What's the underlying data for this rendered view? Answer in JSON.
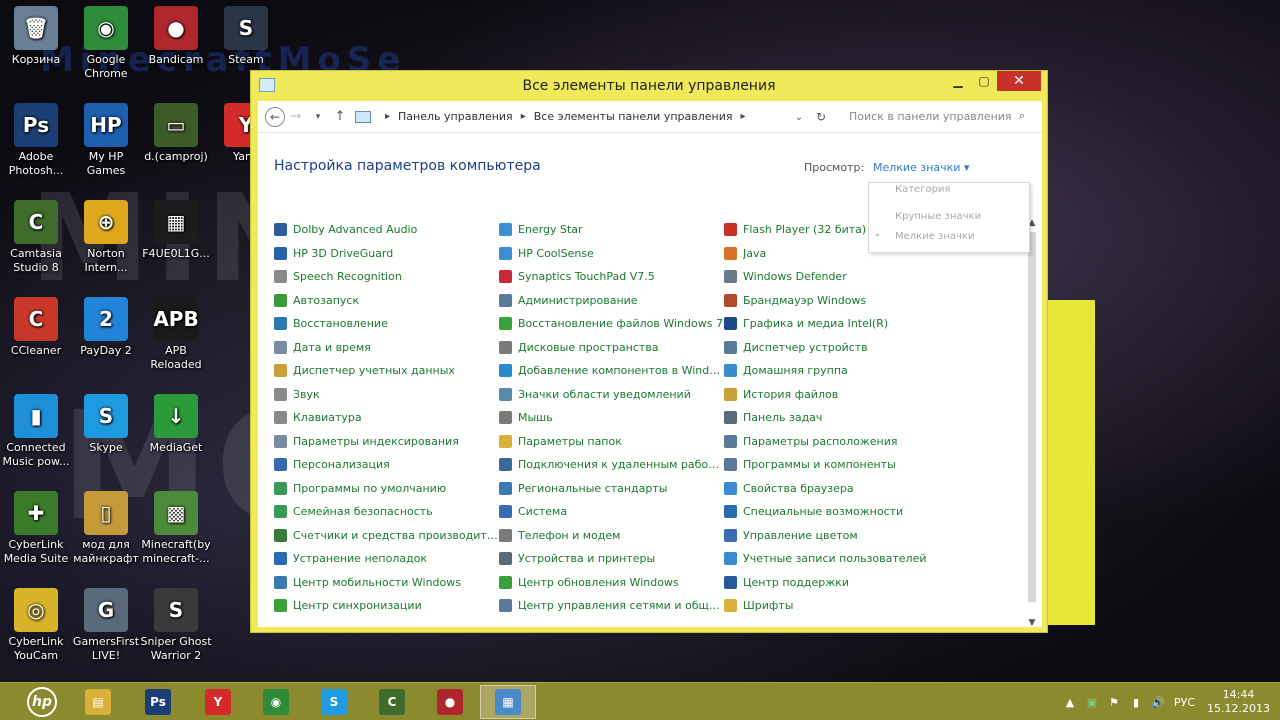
{
  "desktop": {
    "icons": [
      {
        "label": "Корзина",
        "icon": "recycle-bin-icon",
        "color": "#6a7f95",
        "glyph": "🗑"
      },
      {
        "label": "Google Chrome",
        "icon": "chrome-icon",
        "color": "#2e8b3a",
        "glyph": "◉"
      },
      {
        "label": "Bandicam",
        "icon": "bandicam-icon",
        "color": "#b0262d",
        "glyph": "●"
      },
      {
        "label": "Steam",
        "icon": "steam-icon",
        "color": "#2a3546",
        "glyph": "S"
      },
      {
        "label": "Adobe Photosh...",
        "icon": "photoshop-icon",
        "color": "#1b3f75",
        "glyph": "Ps"
      },
      {
        "label": "My HP Games",
        "icon": "hp-games-icon",
        "color": "#1f5fb0",
        "glyph": "HP"
      },
      {
        "label": "d.(camproj)",
        "icon": "camproj-icon",
        "color": "#3d5a2a",
        "glyph": "▭"
      },
      {
        "label": "Yand",
        "icon": "yandex-icon",
        "color": "#d42a2a",
        "glyph": "Y"
      },
      {
        "label": "Camtasia Studio 8",
        "icon": "camtasia-icon",
        "color": "#3f6b2d",
        "glyph": "C"
      },
      {
        "label": "Norton Intern...",
        "icon": "norton-icon",
        "color": "#e0a81c",
        "glyph": "⊕"
      },
      {
        "label": "F4UE0L1G...",
        "icon": "image-file-icon",
        "color": "#1c1c1c",
        "glyph": "▦"
      },
      {
        "label": "CCleaner",
        "icon": "ccleaner-icon",
        "color": "#c8382a",
        "glyph": "C"
      },
      {
        "label": "PayDay 2",
        "icon": "payday-icon",
        "color": "#2284d8",
        "glyph": "2"
      },
      {
        "label": "APB Reloaded",
        "icon": "apb-icon",
        "color": "#1a1a1a",
        "glyph": "APB"
      },
      {
        "label": "Connected Music pow...",
        "icon": "music-icon",
        "color": "#1e8fd8",
        "glyph": "▮"
      },
      {
        "label": "Skype",
        "icon": "skype-icon",
        "color": "#1e9ae0",
        "glyph": "S"
      },
      {
        "label": "MediaGet",
        "icon": "mediaget-icon",
        "color": "#2a9a3a",
        "glyph": "↓"
      },
      {
        "label": "CyberLink Media Suite",
        "icon": "cyberlink-suite-icon",
        "color": "#3a7a2a",
        "glyph": "✚"
      },
      {
        "label": "мод для майнкрафт",
        "icon": "folder-icon",
        "color": "#c49a3a",
        "glyph": "▯"
      },
      {
        "label": "Minecraft(by minecraft-...",
        "icon": "minecraft-icon",
        "color": "#4d8a3a",
        "glyph": "▩"
      },
      {
        "label": "CyberLink YouCam",
        "icon": "youcam-icon",
        "color": "#d8b22a",
        "glyph": "◎"
      },
      {
        "label": "GamersFirst LIVE!",
        "icon": "gamersfirst-icon",
        "color": "#5a6a7a",
        "glyph": "G"
      },
      {
        "label": "Sniper Ghost Warrior 2",
        "icon": "sniper-icon",
        "color": "#3a3a3a",
        "glyph": "S"
      }
    ]
  },
  "window": {
    "title": "Все элементы панели управления",
    "breadcrumbs": [
      "Панель управления",
      "Все элементы панели управления"
    ],
    "search_placeholder": "Поиск в панели управления",
    "page_title": "Настройка параметров компьютера",
    "view_label": "Просмотр:",
    "view_value": "Мелкие значки ▾",
    "view_options": [
      "Категория",
      "Крупные значки",
      "Мелкие значки"
    ],
    "view_selected": "•",
    "items": [
      {
        "label": "Dolby Advanced Audio",
        "color": "#2a5d9a"
      },
      {
        "label": "Energy Star",
        "color": "#3a8fd0"
      },
      {
        "label": "Flash Player (32 бита)",
        "color": "#c8302a"
      },
      {
        "label": "HP 3D DriveGuard",
        "color": "#2a5faa"
      },
      {
        "label": "HP CoolSense",
        "color": "#3a8fd0"
      },
      {
        "label": "Java",
        "color": "#d8702a"
      },
      {
        "label": "Speech Recognition",
        "color": "#8a8a8a"
      },
      {
        "label": "Synaptics TouchPad V7.5",
        "color": "#c82a3a"
      },
      {
        "label": "Windows Defender",
        "color": "#6a7a8a"
      },
      {
        "label": "Автозапуск",
        "color": "#3a9a3a"
      },
      {
        "label": "Администрирование",
        "color": "#5a7a9a"
      },
      {
        "label": "Брандмауэр Windows",
        "color": "#b04a2a"
      },
      {
        "label": "Восстановление",
        "color": "#2a7ab0"
      },
      {
        "label": "Восстановление файлов Windows 7",
        "color": "#3aa03a"
      },
      {
        "label": "Графика и медиа Intel(R)",
        "color": "#1a4a8a"
      },
      {
        "label": "Дата и время",
        "color": "#7a8aa0"
      },
      {
        "label": "Дисковые пространства",
        "color": "#7a7a7a"
      },
      {
        "label": "Диспетчер устройств",
        "color": "#5a7a9a"
      },
      {
        "label": "Диспетчер учетных данных",
        "color": "#c8a03a"
      },
      {
        "label": "Добавление компонентов в Windo...",
        "color": "#2a8ad0"
      },
      {
        "label": "Домашняя группа",
        "color": "#3a8ad0"
      },
      {
        "label": "Звук",
        "color": "#8a8a8a"
      },
      {
        "label": "Значки области уведомлений",
        "color": "#5a8aaa"
      },
      {
        "label": "История файлов",
        "color": "#c8a03a"
      },
      {
        "label": "Клавиатура",
        "color": "#8a8a8a"
      },
      {
        "label": "Мышь",
        "color": "#7a7a7a"
      },
      {
        "label": "Панель задач",
        "color": "#5a6a7a"
      },
      {
        "label": "Параметры индексирования",
        "color": "#7a8aa0"
      },
      {
        "label": "Параметры папок",
        "color": "#d8b03a"
      },
      {
        "label": "Параметры расположения",
        "color": "#5a7a9a"
      },
      {
        "label": "Персонализация",
        "color": "#3a6ab0"
      },
      {
        "label": "Подключения к удаленным рабоч...",
        "color": "#3a6a9a"
      },
      {
        "label": "Программы и компоненты",
        "color": "#5a7a9a"
      },
      {
        "label": "Программы по умолчанию",
        "color": "#3a9a5a"
      },
      {
        "label": "Региональные стандарты",
        "color": "#3a7ab0"
      },
      {
        "label": "Свойства браузера",
        "color": "#3a8ad0"
      },
      {
        "label": "Семейная безопасность",
        "color": "#3a9a5a"
      },
      {
        "label": "Система",
        "color": "#3a6ab0"
      },
      {
        "label": "Специальные возможности",
        "color": "#2a6ab0"
      },
      {
        "label": "Счетчики и средства производител...",
        "color": "#3a7a3a"
      },
      {
        "label": "Телефон и модем",
        "color": "#7a7a7a"
      },
      {
        "label": "Управление цветом",
        "color": "#3a6ab0"
      },
      {
        "label": "Устранение неполадок",
        "color": "#2a6ab0"
      },
      {
        "label": "Устройства и принтеры",
        "color": "#5a6a7a"
      },
      {
        "label": "Учетные записи пользователей",
        "color": "#3a8ad0"
      },
      {
        "label": "Центр мобильности Windows",
        "color": "#3a7ab0"
      },
      {
        "label": "Центр обновления Windows",
        "color": "#3aa03a"
      },
      {
        "label": "Центр поддержки",
        "color": "#2a5a9a"
      },
      {
        "label": "Центр синхронизации",
        "color": "#3aa03a"
      },
      {
        "label": "Центр управления сетями и общи...",
        "color": "#5a7a9a"
      },
      {
        "label": "Шрифты",
        "color": "#d8b03a"
      }
    ]
  },
  "taskbar": {
    "apps": [
      {
        "name": "explorer",
        "icon": "folder-icon",
        "color": "#d8b03a",
        "glyph": "▤",
        "active": false
      },
      {
        "name": "photoshop",
        "icon": "photoshop-icon",
        "color": "#1b3f75",
        "glyph": "Ps",
        "active": false
      },
      {
        "name": "yandex",
        "icon": "yandex-icon",
        "color": "#d42a2a",
        "glyph": "Y",
        "active": false
      },
      {
        "name": "chrome",
        "icon": "chrome-icon",
        "color": "#2e8b3a",
        "glyph": "◉",
        "active": false
      },
      {
        "name": "skype",
        "icon": "skype-icon",
        "color": "#1e9ae0",
        "glyph": "S",
        "active": false
      },
      {
        "name": "camtasia",
        "icon": "camtasia-icon",
        "color": "#3f6b2d",
        "glyph": "C",
        "active": false
      },
      {
        "name": "bandicam",
        "icon": "bandicam-icon",
        "color": "#b0262d",
        "glyph": "●",
        "active": false
      },
      {
        "name": "control-panel",
        "icon": "control-panel-icon",
        "color": "#4a8ac8",
        "glyph": "▦",
        "active": true
      }
    ],
    "language": "РУС",
    "time": "14:44",
    "date": "15.12.2013"
  }
}
